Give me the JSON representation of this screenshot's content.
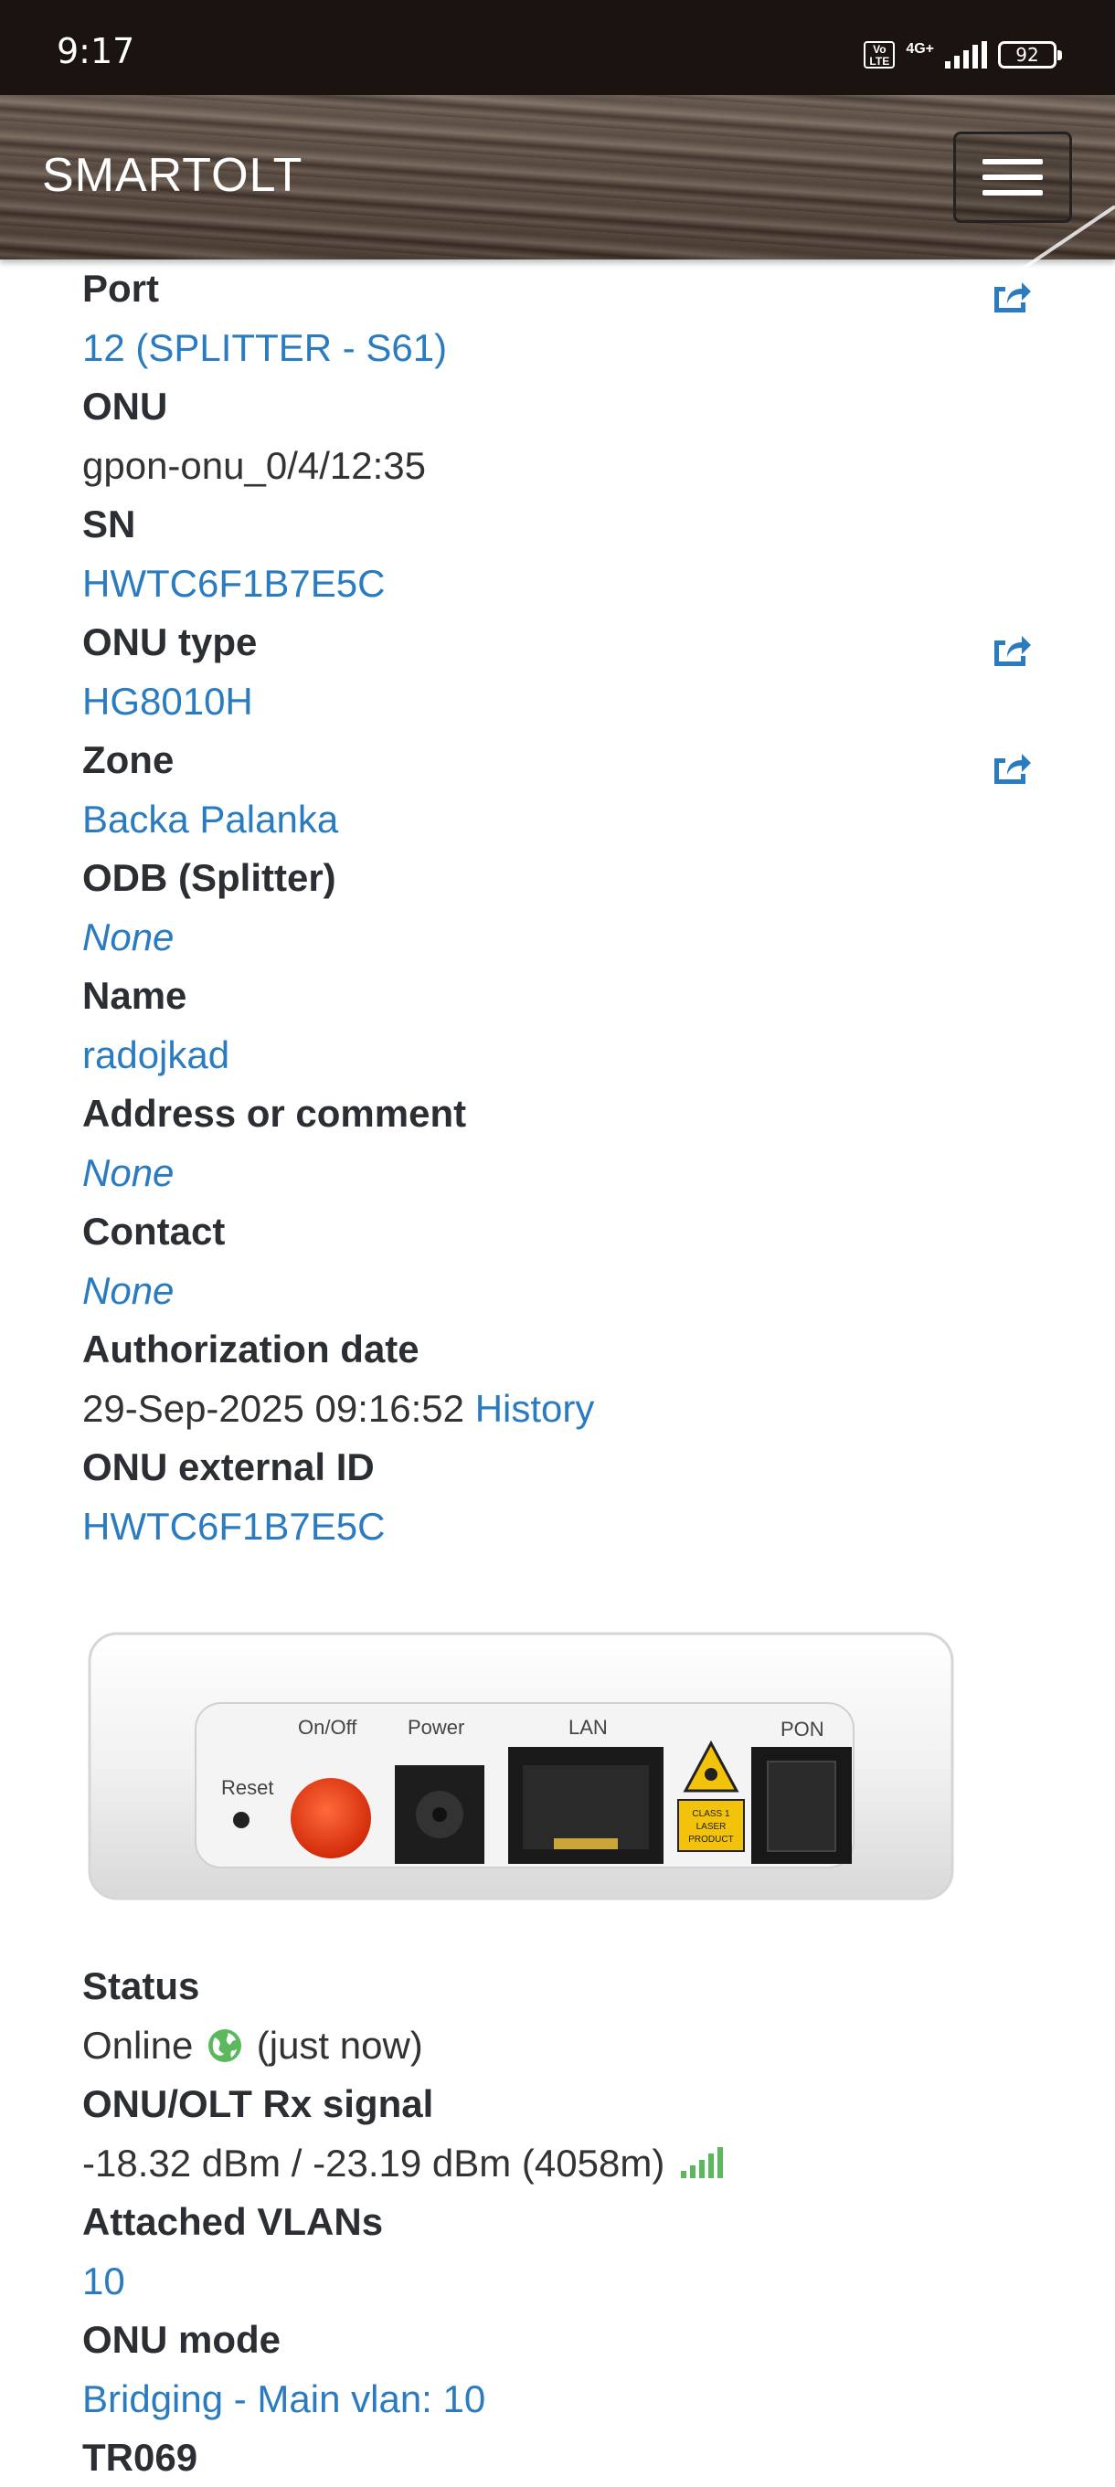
{
  "status_bar": {
    "time": "9:17",
    "volte": "Vo LTE",
    "network": "4G+",
    "battery": "92"
  },
  "navbar": {
    "brand": "SMARTOLT",
    "menu_icon": "hamburger-menu-icon"
  },
  "fields": [
    {
      "label": "Port",
      "value": "12 (SPLITTER - S61)",
      "style": "link",
      "editable": true
    },
    {
      "label": "ONU",
      "value": "gpon-onu_0/4/12:35",
      "style": "plain",
      "editable": false
    },
    {
      "label": "SN",
      "value": "HWTC6F1B7E5C",
      "style": "link",
      "editable": false
    },
    {
      "label": "ONU type",
      "value": "HG8010H",
      "style": "link",
      "editable": true
    },
    {
      "label": "Zone",
      "value": "Backa Palanka",
      "style": "link",
      "editable": true
    },
    {
      "label": "ODB (Splitter)",
      "value": "None",
      "style": "italic",
      "editable": false
    },
    {
      "label": "Name",
      "value": "radojkad",
      "style": "link",
      "editable": false
    },
    {
      "label": "Address or comment",
      "value": "None",
      "style": "italic",
      "editable": false
    },
    {
      "label": "Contact",
      "value": "None",
      "style": "italic",
      "editable": false
    },
    {
      "label": "Authorization date",
      "value": "29-Sep-2025 09:16:52",
      "extra_link": "History",
      "style": "plain",
      "editable": false
    },
    {
      "label": "ONU external ID",
      "value": "HWTC6F1B7E5C",
      "style": "link",
      "editable": false
    }
  ],
  "device_image": {
    "labels": [
      "Reset",
      "On/Off",
      "Power",
      "LAN",
      "PON"
    ],
    "laser_label": "CLASS 1 LASER PRODUCT"
  },
  "status": {
    "status_label": "Status",
    "status_value": "Online",
    "status_suffix": "(just now)",
    "signal_label": "ONU/OLT Rx signal",
    "signal_value": "-18.32 dBm / -23.19 dBm (4058m)",
    "vlans_label": "Attached VLANs",
    "vlans_value": "10",
    "mode_label": "ONU mode",
    "mode_value": "Bridging - Main vlan: 10",
    "tr069_label": "TR069"
  },
  "colors": {
    "link": "#2a7bbf",
    "label": "#2b2f33",
    "online_green": "#5cb85c"
  }
}
